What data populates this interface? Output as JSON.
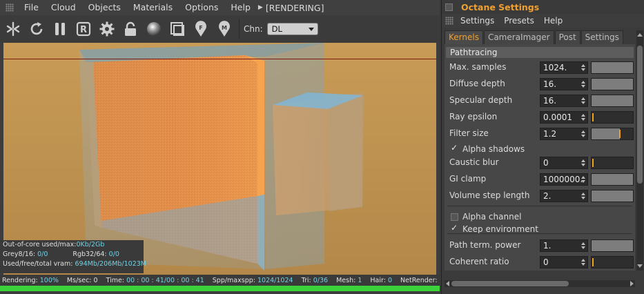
{
  "viewer": {
    "menu": [
      "File",
      "Cloud",
      "Objects",
      "Materials",
      "Options",
      "Help"
    ],
    "status": "[RENDERING]",
    "toolbar_icons": [
      "send-to-viewport-icon",
      "restart-icon",
      "pause-icon",
      "region-render-icon",
      "settings-gear-icon",
      "lock-icon",
      "material-sphere-icon",
      "film-region-icon",
      "focus-picker-icon",
      "material-picker-icon"
    ],
    "channel_label": "Chn:",
    "channel_value": "DL"
  },
  "info": {
    "out_of_core_label": "Out-of-core used/max:",
    "out_of_core_value": "0Kb/2Gb",
    "grey_label": "Grey8/16:",
    "grey_value": "0/0",
    "rgb_label": "Rgb32/64:",
    "rgb_value": "0/0",
    "vram_label": "Used/free/total vram:",
    "vram_value": "694Mb/206Mb/1023M"
  },
  "statusbar": {
    "rendering_label": "Rendering:",
    "rendering_value": "100%",
    "ms_label": "Ms/sec:",
    "ms_value": "0",
    "time_label": "Time:",
    "time_value": "00 : 00 : 41/00 : 00 : 41",
    "spp_label": "Spp/maxspp:",
    "spp_value": "1024/1024",
    "tri_label": "Tri:",
    "tri_value": "0/36",
    "mesh_label": "Mesh:",
    "mesh_value": "1",
    "hair_label": "Hair:",
    "hair_value": "0",
    "netrender_label": "NetRender:",
    "progress": 1.0
  },
  "settings": {
    "title": "Octane Settings",
    "menu": [
      "Settings",
      "Presets",
      "Help"
    ],
    "tabs": [
      "Kernels",
      "CameraImager",
      "Post",
      "Settings"
    ],
    "section": "Pathtracing",
    "params": [
      {
        "label": "Max. samples",
        "value": "1024.",
        "fill": 1.0
      },
      {
        "label": "Diffuse depth",
        "value": "16.",
        "fill": 1.0
      },
      {
        "label": "Specular depth",
        "value": "16.",
        "fill": 1.0
      },
      {
        "label": "Ray epsilon",
        "value": "0.0001",
        "fill": 0.0
      },
      {
        "label": "Filter size",
        "value": "1.2",
        "fill": 0.68
      },
      {
        "label": "Caustic blur",
        "value": "0",
        "fill": 0.0
      },
      {
        "label": "GI clamp",
        "value": "1000000.",
        "fill": 1.0
      },
      {
        "label": "Volume step length",
        "value": "2.",
        "fill": 1.0
      },
      {
        "label": "Path term. power",
        "value": "1.",
        "fill": 1.0
      },
      {
        "label": "Coherent ratio",
        "value": "0",
        "fill": 0.0
      }
    ],
    "checks": [
      {
        "label": "Alpha shadows",
        "checked": true
      },
      {
        "label": "Alpha channel",
        "checked": false
      },
      {
        "label": "Keep environment",
        "checked": true
      }
    ]
  },
  "colors": {
    "accent": "#f0a030",
    "progress": "#3bd23b",
    "info_value": "#6fd3e8"
  }
}
